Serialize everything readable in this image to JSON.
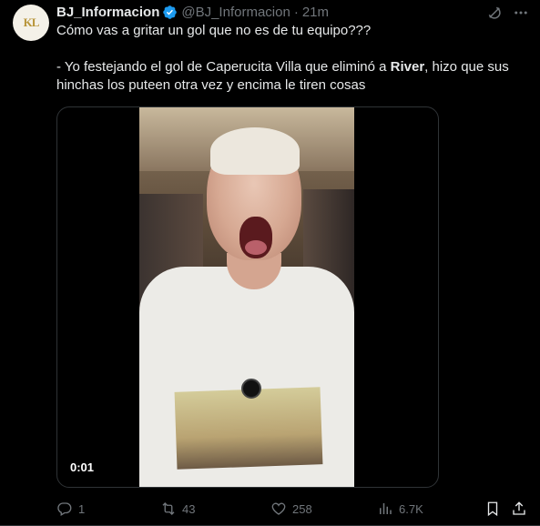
{
  "author": {
    "avatar_monogram": "KL",
    "name": "BJ_Informacion",
    "handle": "@BJ_Informacion",
    "separator": "·",
    "time": "21m",
    "verified": true
  },
  "tweet": {
    "line1": "Cómo vas a gritar un gol que no es de tu equipo???",
    "line2_pre": "- Yo festejando el gol de Caperucita Villa que eliminó a ",
    "line2_bold": "River",
    "line2_post": ", hizo que sus hinchas los puteen otra vez y encima le tiren cosas"
  },
  "media": {
    "duration": "0:01"
  },
  "actions": {
    "replies": "1",
    "retweets": "43",
    "likes": "258",
    "views": "6.7K"
  },
  "icons": {
    "verified": "verified-badge-icon",
    "grok": "grok-icon",
    "more": "more-icon",
    "reply": "reply-icon",
    "retweet": "retweet-icon",
    "like": "heart-icon",
    "views": "views-icon",
    "bookmark": "bookmark-icon",
    "share": "share-icon"
  },
  "colors": {
    "background": "#000000",
    "text": "#e7e9ea",
    "secondary": "#71767b",
    "verified": "#1d9bf0",
    "border": "#2f3336"
  }
}
